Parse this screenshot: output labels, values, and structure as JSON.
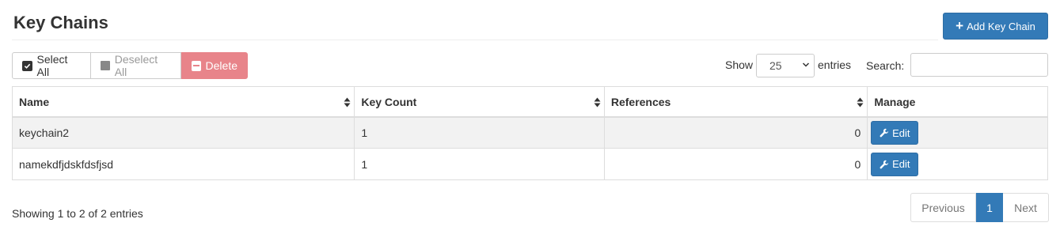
{
  "header": {
    "title": "Key Chains",
    "add_button_label": "Add Key Chain"
  },
  "toolbar": {
    "select_all_label": "Select All",
    "deselect_all_label": "Deselect All",
    "delete_label": "Delete"
  },
  "length_control": {
    "show_label": "Show",
    "selected": "25",
    "entries_label": "entries"
  },
  "search": {
    "label": "Search:",
    "value": ""
  },
  "table": {
    "columns": [
      "Name",
      "Key Count",
      "References",
      "Manage"
    ],
    "rows": [
      {
        "name": "keychain2",
        "key_count": "1",
        "references": "0",
        "action": "Edit"
      },
      {
        "name": "namekdfjdskfdsfjsd",
        "key_count": "1",
        "references": "0",
        "action": "Edit"
      }
    ]
  },
  "footer": {
    "info": "Showing 1 to 2 of 2 entries",
    "pagination": {
      "previous": "Previous",
      "current": "1",
      "next": "Next"
    }
  },
  "colors": {
    "primary": "#337ab7",
    "danger": "#e8848a",
    "stripe": "#f2f2f2"
  },
  "icons": [
    "plus-icon",
    "checkbox-checked-icon",
    "square-icon",
    "minus-square-icon",
    "sort-icon",
    "chevron-down-icon",
    "wrench-icon"
  ]
}
